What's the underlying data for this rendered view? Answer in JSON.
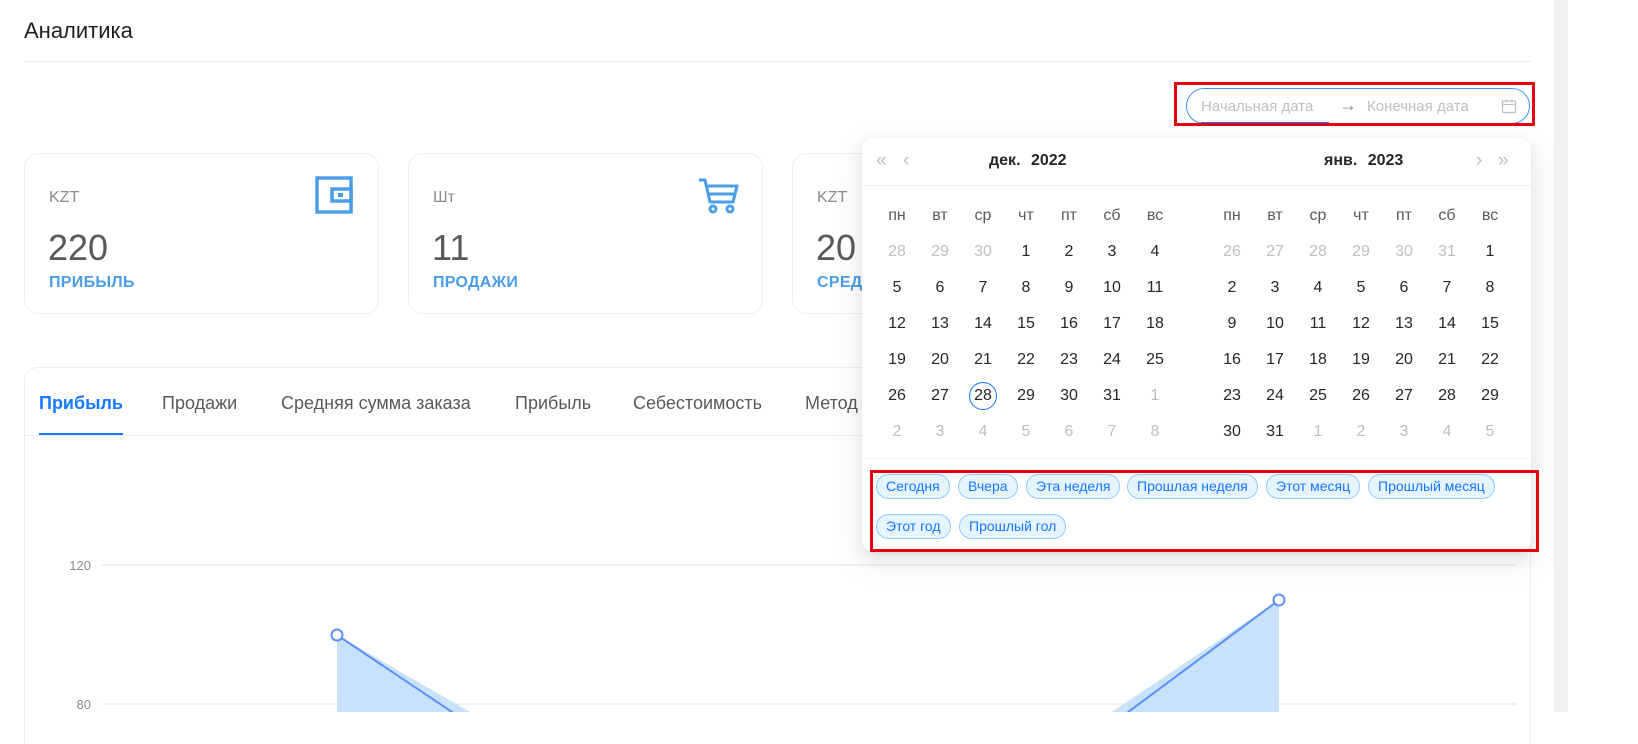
{
  "header": {
    "title": "Аналитика"
  },
  "date_range": {
    "start_placeholder": "Начальная дата",
    "end_placeholder": "Конечная дата",
    "separator": "→",
    "calendar_icon": "calendar-icon"
  },
  "cards": [
    {
      "unit": "KZT",
      "value": "220",
      "label": "ПРИБЫЛЬ",
      "icon": "wallet-icon"
    },
    {
      "unit": "Шт",
      "value": "11",
      "label": "ПРОДАЖИ",
      "icon": "cart-icon"
    },
    {
      "unit": "KZT",
      "value": "20",
      "label": "СРЕД"
    }
  ],
  "tabs": [
    "Прибыль",
    "Продажи",
    "Средняя сумма заказа",
    "Прибыль",
    "Себестоимость",
    "Метод"
  ],
  "chart_data": {
    "type": "area",
    "y_ticks": [
      "120",
      "80"
    ],
    "title": "",
    "xlabel": "",
    "ylabel": "",
    "series": [
      {
        "x_index": [
          0,
          1
        ],
        "values": [
          100,
          0
        ]
      },
      {
        "x_index": [
          0,
          1
        ],
        "values": [
          0,
          110
        ]
      }
    ],
    "ylim": [
      0,
      120
    ],
    "grid": true,
    "colors": {
      "line": "#5b8ff9",
      "fill": "#c9e2fb"
    }
  },
  "calendar": {
    "nav": {
      "prev_year": "«",
      "prev_month": "‹",
      "next_month": "›",
      "next_year": "»"
    },
    "left": {
      "month": "дек.",
      "year": "2022",
      "weekdays": [
        "пн",
        "вт",
        "ср",
        "чт",
        "пт",
        "сб",
        "вс"
      ],
      "weeks": [
        [
          "28",
          "29",
          "30",
          "1",
          "2",
          "3",
          "4"
        ],
        [
          "5",
          "6",
          "7",
          "8",
          "9",
          "10",
          "11"
        ],
        [
          "12",
          "13",
          "14",
          "15",
          "16",
          "17",
          "18"
        ],
        [
          "19",
          "20",
          "21",
          "22",
          "23",
          "24",
          "25"
        ],
        [
          "26",
          "27",
          "28",
          "29",
          "30",
          "31",
          "1"
        ],
        [
          "2",
          "3",
          "4",
          "5",
          "6",
          "7",
          "8"
        ]
      ]
    },
    "right": {
      "month": "янв.",
      "year": "2023",
      "weekdays": [
        "пн",
        "вт",
        "ср",
        "чт",
        "пт",
        "сб",
        "вс"
      ],
      "weeks": [
        [
          "26",
          "27",
          "28",
          "29",
          "30",
          "31",
          "1"
        ],
        [
          "2",
          "3",
          "4",
          "5",
          "6",
          "7",
          "8"
        ],
        [
          "9",
          "10",
          "11",
          "12",
          "13",
          "14",
          "15"
        ],
        [
          "16",
          "17",
          "18",
          "19",
          "20",
          "21",
          "22"
        ],
        [
          "23",
          "24",
          "25",
          "26",
          "27",
          "28",
          "29"
        ],
        [
          "30",
          "31",
          "1",
          "2",
          "3",
          "4",
          "5"
        ]
      ]
    },
    "presets": [
      "Сегодня",
      "Вчера",
      "Эта неделя",
      "Прошлая неделя",
      "Этот месяц",
      "Прошлый месяц",
      "Этот год",
      "Прошлый гол"
    ]
  }
}
